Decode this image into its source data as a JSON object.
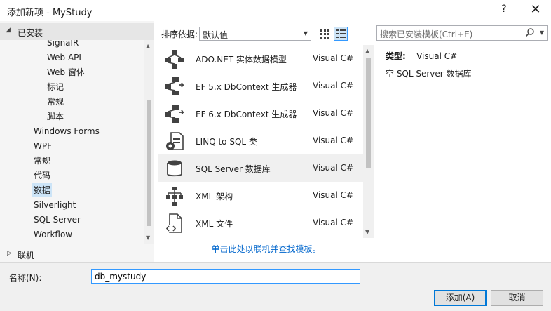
{
  "window": {
    "title": "添加新项 - MyStudy",
    "help_label": "?",
    "close_label": "✕"
  },
  "left": {
    "installed_label": "已安装",
    "tree_items": [
      {
        "label": "SignalR",
        "indent": 2
      },
      {
        "label": "Web API",
        "indent": 2
      },
      {
        "label": "Web 窗体",
        "indent": 2
      },
      {
        "label": "标记",
        "indent": 2
      },
      {
        "label": "常规",
        "indent": 2
      },
      {
        "label": "脚本",
        "indent": 2
      },
      {
        "label": "Windows Forms",
        "indent": 1
      },
      {
        "label": "WPF",
        "indent": 1
      },
      {
        "label": "常规",
        "indent": 1
      },
      {
        "label": "代码",
        "indent": 1
      },
      {
        "label": "数据",
        "indent": 1,
        "selected": true
      },
      {
        "label": "Silverlight",
        "indent": 1
      },
      {
        "label": "SQL Server",
        "indent": 1
      },
      {
        "label": "Workflow",
        "indent": 1
      }
    ],
    "online_label": "联机"
  },
  "sort": {
    "label": "排序依据:",
    "value": "默认值"
  },
  "templates": [
    {
      "name": "ADO.NET 实体数据模型",
      "lang": "Visual C#",
      "icon": "entity-model-icon"
    },
    {
      "name": "EF 5.x DbContext 生成器",
      "lang": "Visual C#",
      "icon": "dbcontext-generator-icon"
    },
    {
      "name": "EF 6.x DbContext 生成器",
      "lang": "Visual C#",
      "icon": "dbcontext-generator-icon"
    },
    {
      "name": "LINQ to SQL 类",
      "lang": "Visual C#",
      "icon": "linq-to-sql-icon"
    },
    {
      "name": "SQL Server 数据库",
      "lang": "Visual C#",
      "icon": "database-icon",
      "selected": true
    },
    {
      "name": "XML 架构",
      "lang": "Visual C#",
      "icon": "xml-schema-icon"
    },
    {
      "name": "XML 文件",
      "lang": "Visual C#",
      "icon": "xml-file-icon"
    }
  ],
  "online_link": "单击此处以联机并查找模板。",
  "search": {
    "placeholder": "搜索已安装模板(Ctrl+E)"
  },
  "details": {
    "type_label": "类型:",
    "type_value": "Visual C#",
    "description": "空 SQL Server 数据库"
  },
  "bottom": {
    "name_label": "名称(N):",
    "name_value": "db_mystudy",
    "ok_label": "添加(A)",
    "cancel_label": "取消"
  },
  "colors": {
    "accent": "#0078d7",
    "selection": "#cce4f7",
    "link": "#0066cc"
  }
}
